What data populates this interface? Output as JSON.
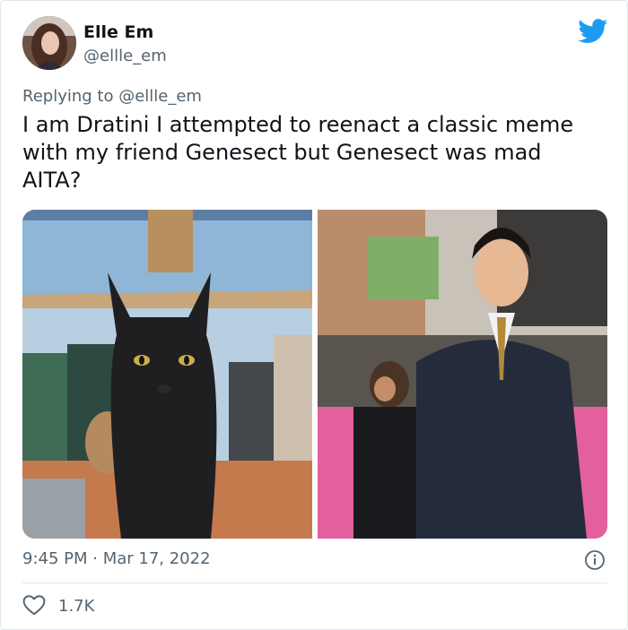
{
  "author": {
    "name": "Elle Em",
    "handle": "@ellle_em"
  },
  "reply": {
    "prefix": "Replying to ",
    "to": "@ellle_em"
  },
  "tweet": {
    "text": "I am Dratini I attempted to reenact a classic meme\nwith my friend Genesect but Genesect was mad\nAITA?",
    "timestamp": "9:45 PM · Mar 17, 2022",
    "likes": "1.7K"
  },
  "icons": {
    "logo": "twitter-bird-icon",
    "info": "info-icon",
    "like": "heart-outline-icon"
  },
  "colors": {
    "brand": "#1d9bf0",
    "text": "#0f1419",
    "secondary": "#536471",
    "divider": "#e1e8ed"
  }
}
